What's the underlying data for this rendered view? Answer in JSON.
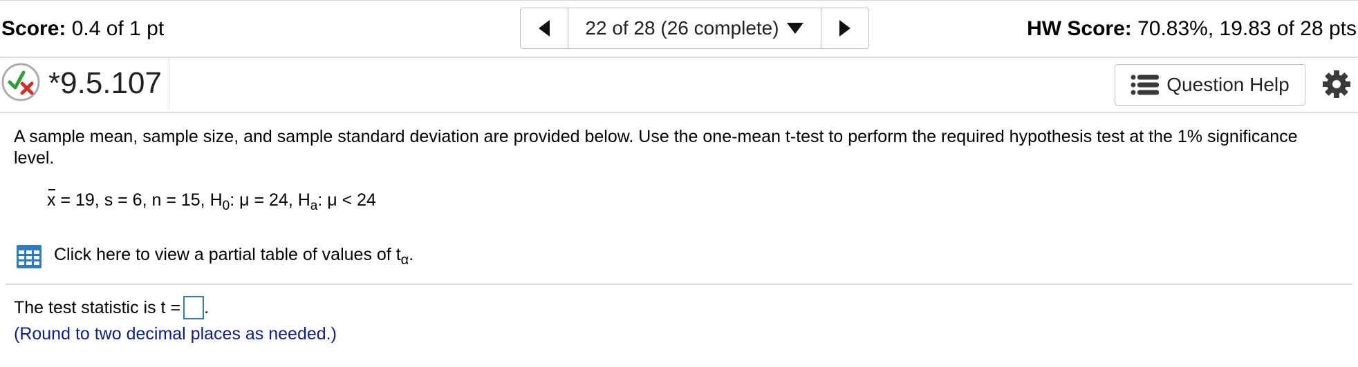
{
  "header": {
    "score_label": "Score:",
    "score_value": "0.4 of 1 pt",
    "nav_label": "22 of 28 (26 complete)",
    "hw_label": "HW Score:",
    "hw_value": "70.83%, 19.83 of 28 pts"
  },
  "question": {
    "number": "*9.5.107",
    "status_icon": "partial-credit-icon",
    "help_label": "Question Help",
    "help_icon": "list-icon",
    "settings_icon": "gear-icon"
  },
  "problem": {
    "instructions": "A sample mean, sample size, and sample standard deviation are provided below. Use the one-mean t-test to perform the required hypothesis test at the 1% significance level.",
    "formula": {
      "xbar": "x",
      "part1": " = 19, s = 6, n = 15, H",
      "h0_sub": "0",
      "part2": ": μ = 24, H",
      "ha_sub": "a",
      "part3": ": μ < 24"
    },
    "table_link": {
      "icon": "table-icon",
      "text": "Click here to view a partial table of values of t",
      "sub": "α",
      "suffix": "."
    }
  },
  "answer": {
    "prefix": "The test statistic is t = ",
    "value": "",
    "suffix": ".",
    "note": "(Round to two decimal places as needed.)"
  },
  "colors": {
    "accent_blue": "#2f7bbf",
    "note_color": "#0b1f8a",
    "correct_green": "#2e9e3a",
    "incorrect_red": "#d32f2f"
  }
}
